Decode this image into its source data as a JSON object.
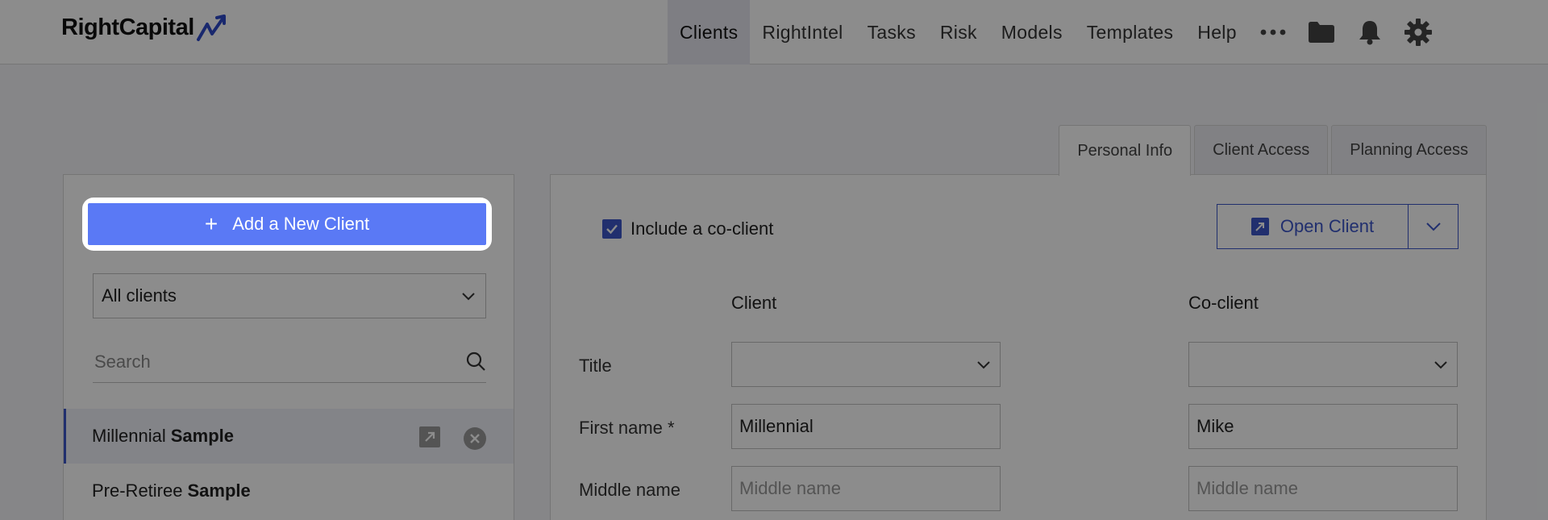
{
  "header": {
    "logo_text": "RightCapital",
    "nav": [
      "Clients",
      "RightIntel",
      "Tasks",
      "Risk",
      "Models",
      "Templates",
      "Help"
    ],
    "more_label": "•••"
  },
  "tabs": [
    "Personal Info",
    "Client Access",
    "Planning Access"
  ],
  "left": {
    "add_client_label": "Add a New Client",
    "filter_selected": "All clients",
    "search_placeholder": "Search",
    "clients": [
      {
        "first": "Millennial",
        "last": "Sample"
      },
      {
        "first": "Pre-Retiree",
        "last": "Sample"
      }
    ]
  },
  "right": {
    "include_coclient_label": "Include a co-client",
    "open_client_label": "Open Client",
    "col_client": "Client",
    "col_coclient": "Co-client",
    "labels": {
      "title": "Title",
      "first_name": "First name *",
      "middle_name": "Middle name"
    },
    "client": {
      "first_name": "Millennial",
      "middle_placeholder": "Middle name"
    },
    "coclient": {
      "first_name": "Mike",
      "middle_placeholder": "Middle name"
    }
  },
  "colors": {
    "accent": "#3d57c9",
    "button": "#5a79f5"
  }
}
